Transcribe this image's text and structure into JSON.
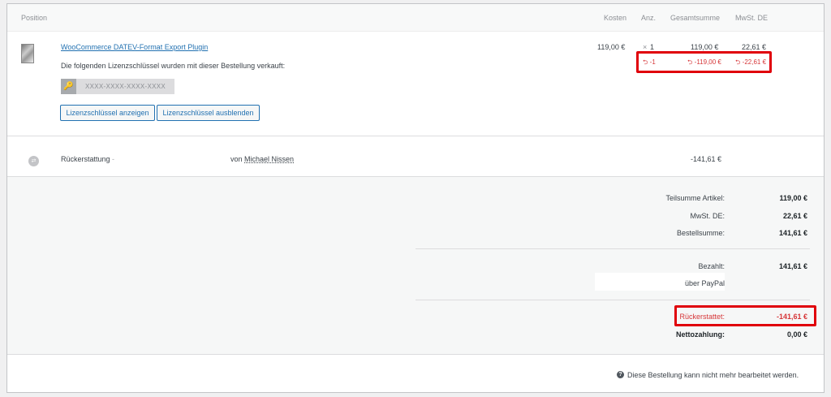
{
  "header": {
    "position": "Position",
    "kosten": "Kosten",
    "anz": "Anz.",
    "gesamtsumme": "Gesamtsumme",
    "mwst": "MwSt. DE"
  },
  "item": {
    "name": "WooCommerce DATEV-Format Export Plugin",
    "license_note": "Die folgenden Lizenzschlüssel wurden mit dieser Bestellung verkauft:",
    "license_key": "XXXX-XXXX-XXXX-XXXX",
    "show_button": "Lizenzschlüssel anzeigen",
    "hide_button": "Lizenzschlüssel ausblenden",
    "cost": "119,00 €",
    "qty_symbol": "×",
    "qty": "1",
    "total": "119,00 €",
    "tax": "22,61 €",
    "refund_qty": "-1",
    "refund_total": "-119,00 €",
    "refund_tax": "-22,61 €"
  },
  "refund": {
    "label": "Rückerstattung",
    "marker": "-",
    "by_prefix": "von",
    "by_name": "Michael Nissen",
    "amount": "-141,61 €"
  },
  "totals": {
    "subtotal_label": "Teilsumme Artikel:",
    "subtotal_value": "119,00 €",
    "tax_label": "MwSt. DE:",
    "tax_value": "22,61 €",
    "order_label": "Bestellsumme:",
    "order_value": "141,61 €",
    "paid_label": "Bezahlt:",
    "paid_value": "141,61 €",
    "paid_via": "über PayPal",
    "refunded_label": "Rückerstattet:",
    "refunded_value": "-141,61 €",
    "net_label": "Nettozahlung:",
    "net_value": "0,00 €"
  },
  "footer": {
    "note": "Diese Bestellung kann nicht mehr bearbeitet werden."
  },
  "colors": {
    "link": "#2271b1",
    "refund_red": "#d63638",
    "highlight": "#e0000a"
  }
}
